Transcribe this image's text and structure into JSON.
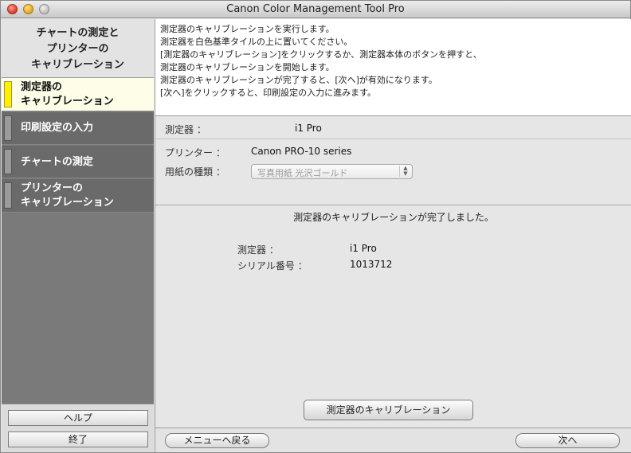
{
  "window": {
    "title": "Canon Color Management Tool Pro"
  },
  "sidebar": {
    "header_lines": [
      "チャートの測定と",
      "プリンターの",
      "キャリブレーション"
    ],
    "steps": [
      {
        "lines": [
          "測定器の",
          "キャリブレーション"
        ],
        "active": true
      },
      {
        "lines": [
          "印刷設定の入力"
        ],
        "active": false
      },
      {
        "lines": [
          "チャートの測定"
        ],
        "active": false
      },
      {
        "lines": [
          "プリンターの",
          "キャリブレーション"
        ],
        "active": false
      }
    ],
    "help_label": "ヘルプ",
    "quit_label": "終了"
  },
  "description": {
    "lines": [
      "測定器のキャリブレーションを実行します。",
      "測定器を白色基準タイルの上に置いてください。",
      "[測定器のキャリブレーション]をクリックするか、測定器本体のボタンを押すと、",
      "測定器のキャリブレーションを開始します。",
      "測定器のキャリブレーションが完了すると、[次へ]が有効になります。",
      "[次へ]をクリックすると、印刷設定の入力に進みます。"
    ]
  },
  "device_info": {
    "label": "測定器 ：",
    "value": "i1 Pro"
  },
  "printer_info": {
    "printer_label": "プリンター ：",
    "printer_value": "Canon PRO-10 series",
    "paper_label": "用紙の種類 ：",
    "paper_value": "写真用紙 光沢ゴールド"
  },
  "result": {
    "message": "測定器のキャリブレーションが完了しました。",
    "device_label": "測定器 ：",
    "device_value": "i1 Pro",
    "serial_label": "シリアル番号 ：",
    "serial_value": "1013712"
  },
  "buttons": {
    "calibrate": "測定器のキャリブレーション",
    "back_to_menu": "メニューへ戻る",
    "next": "次へ"
  }
}
